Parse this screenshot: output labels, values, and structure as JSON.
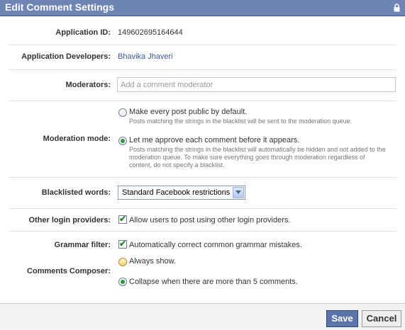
{
  "dialog": {
    "title": "Edit Comment Settings",
    "lock_icon": "lock-icon"
  },
  "app_id": {
    "label": "Application ID:",
    "value": "149602695164644"
  },
  "developers": {
    "label": "Application Developers:",
    "value": "Bhavika Jhaveri"
  },
  "moderators": {
    "label": "Moderators:",
    "placeholder": "Add a comment moderator"
  },
  "moderation": {
    "label": "Moderation mode:",
    "option1": {
      "text": "Make every post public by default.",
      "sub": "Posts matching the strings in the blacklist will be sent to the moderation queue.",
      "selected": false
    },
    "option2": {
      "text": "Let me approve each comment before it appears.",
      "sub_line1": "Posts matching the strings in the blacklist will automatically be hidden and not added to the",
      "sub_line2": "moderation queue. To make sure everything goes through moderation regardless of",
      "sub_line3": "content, do not specify a blacklist.",
      "selected": true
    }
  },
  "blacklist": {
    "label": "Blacklisted words:",
    "selected": "Standard Facebook restrictions"
  },
  "login_providers": {
    "label": "Other login providers:",
    "text": "Allow users to post using other login providers.",
    "checked": true
  },
  "grammar": {
    "label": "Grammar filter:",
    "text": "Automatically correct common grammar mistakes.",
    "checked": true
  },
  "composer": {
    "label": "Comments Composer:",
    "option1": {
      "text": "Always show.",
      "selected": false
    },
    "option2": {
      "text": "Collapse when there are more than 5 comments.",
      "selected": true
    }
  },
  "footer": {
    "save_label": "Save",
    "cancel_label": "Cancel"
  },
  "colors": {
    "titlebar": "#6d84b4",
    "link": "#3b5998",
    "save_button": "#5b74a8"
  }
}
